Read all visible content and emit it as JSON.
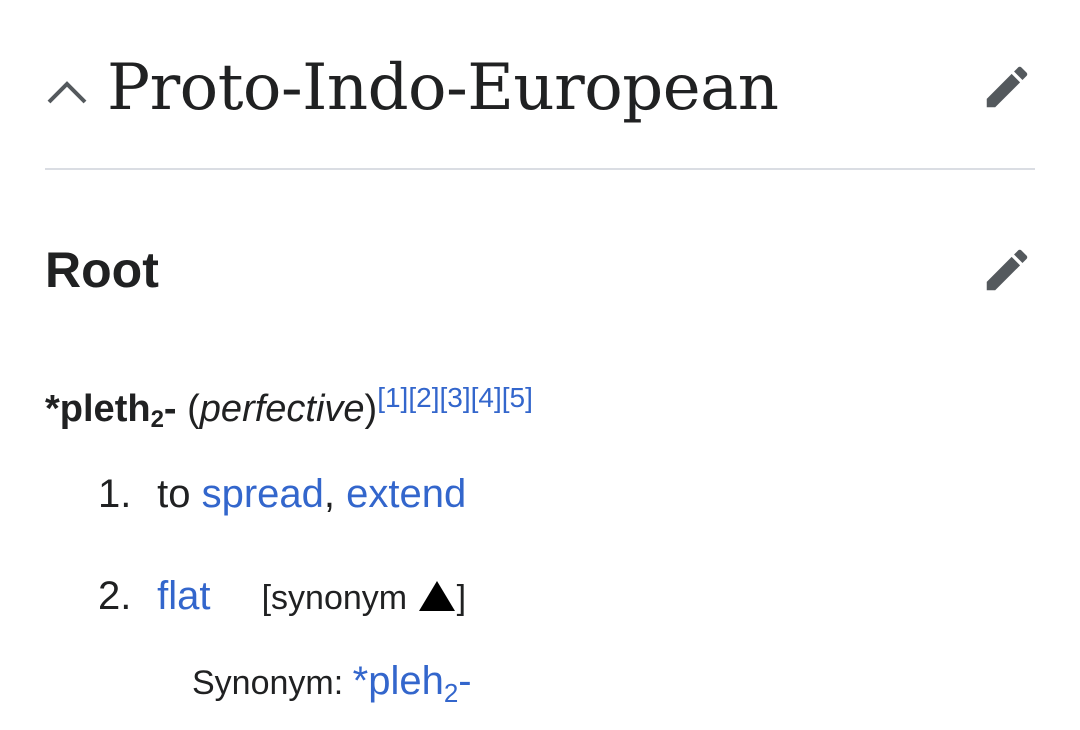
{
  "section": {
    "title": "Proto-Indo-European"
  },
  "subsection": {
    "title": "Root"
  },
  "headword": {
    "prefix": "*pleth",
    "subscript": "2",
    "suffix": "-",
    "open_paren": "(",
    "aspect": "perfective",
    "close_paren": ")",
    "refs": [
      "[1]",
      "[2]",
      "[3]",
      "[4]",
      "[5]"
    ]
  },
  "definitions": [
    {
      "number": "1.",
      "text_before": "to ",
      "link1": "spread",
      "separator": ", ",
      "link2": "extend"
    },
    {
      "number": "2.",
      "link1": "flat",
      "toggle_open": "[synonym ",
      "toggle_close": "]"
    }
  ],
  "synonym": {
    "label": "Synonym: ",
    "word_prefix": "*pleh",
    "word_subscript": "2",
    "word_suffix": "-"
  },
  "colors": {
    "link": "#3366cc",
    "text": "#202122",
    "icon": "#54595d",
    "divider": "#dadde3"
  },
  "icons": {
    "collapse": "chevron-up-icon",
    "edit": "pencil-icon"
  }
}
